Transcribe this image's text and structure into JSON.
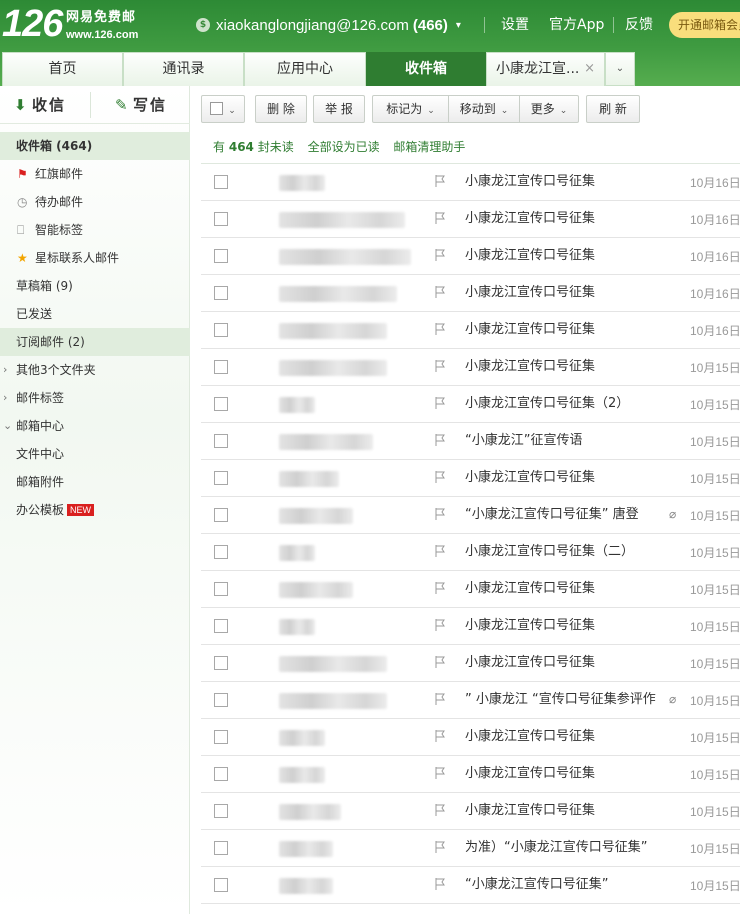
{
  "header": {
    "logo_number": "126",
    "logo_cn": "网易免费邮",
    "logo_url": "www.126.com",
    "coin_icon": "$",
    "account_email": "xiaokanglongjiang@126.com",
    "account_count": "(466)",
    "links": [
      "设置",
      "官方App",
      "反馈"
    ],
    "open_button": "开通邮箱会员"
  },
  "tabs": [
    {
      "label": "首页",
      "active": false
    },
    {
      "label": "通讯录",
      "active": false
    },
    {
      "label": "应用中心",
      "active": false
    },
    {
      "label": "收件箱",
      "active": true
    },
    {
      "label": "小康龙江宣...",
      "active": false,
      "closable": true
    }
  ],
  "tab_close_icon": "×",
  "tab_more_icon": "chevron-down-icon",
  "sidebar": {
    "receive_label": "收信",
    "write_label": "写信",
    "items": [
      {
        "label": "收件箱 (464)",
        "bold": true,
        "highlight": true
      },
      {
        "label": "红旗邮件",
        "icon": "red-flag-icon"
      },
      {
        "label": "待办邮件",
        "icon": "clock-icon"
      },
      {
        "label": "智能标签",
        "icon": "bookmark-icon"
      },
      {
        "label": "星标联系人邮件",
        "icon": "star-icon"
      },
      {
        "label": "草稿箱 (9)"
      },
      {
        "label": "已发送"
      },
      {
        "label": "订阅邮件 (2)",
        "highlight": true
      },
      {
        "label": "其他3个文件夹",
        "arrow": "›"
      },
      {
        "label": "邮件标签",
        "arrow": "›"
      },
      {
        "label": "邮箱中心",
        "arrow": "⌄"
      },
      {
        "label": "文件中心"
      },
      {
        "label": "邮箱附件"
      },
      {
        "label": "办公模板",
        "badge": "NEW"
      }
    ]
  },
  "toolbar": {
    "delete": "删 除",
    "report": "举 报",
    "mark_as": "标记为",
    "move_to": "移动到",
    "more": "更多",
    "refresh": "刷 新"
  },
  "status": {
    "prefix": "有",
    "count": "464",
    "suffix": "封未读",
    "mark_all": "全部设为已读",
    "cleaner": "邮箱清理助手"
  },
  "colors": {
    "header_green": "#3f9b41",
    "active_tab": "#2f7d31",
    "link_green": "#2f7d31",
    "open_button": "#f9de7c",
    "new_badge": "#d9201f"
  },
  "mails": [
    {
      "subject": "小康龙江宣传口号征集",
      "date": "10月16日"
    },
    {
      "subject": "小康龙江宣传口号征集",
      "date": "10月16日"
    },
    {
      "subject": "小康龙江宣传口号征集",
      "date": "10月16日"
    },
    {
      "subject": "小康龙江宣传口号征集",
      "date": "10月16日"
    },
    {
      "subject": "小康龙江宣传口号征集",
      "date": "10月16日"
    },
    {
      "subject": "小康龙江宣传口号征集",
      "date": "10月15日"
    },
    {
      "subject": "小康龙江宣传口号征集（2）",
      "date": "10月15日"
    },
    {
      "subject": "“小康龙江”征宣传语",
      "date": "10月15日"
    },
    {
      "subject": "小康龙江宣传口号征集",
      "date": "10月15日"
    },
    {
      "subject": "“小康龙江宣传口号征集” 唐登",
      "date": "10月15日",
      "attachment": true
    },
    {
      "subject": "小康龙江宣传口号征集（二）",
      "date": "10月15日"
    },
    {
      "subject": "小康龙江宣传口号征集",
      "date": "10月15日"
    },
    {
      "subject": "小康龙江宣传口号征集",
      "date": "10月15日"
    },
    {
      "subject": "小康龙江宣传口号征集",
      "date": "10月15日"
    },
    {
      "subject": "” 小康龙江 “宣传口号征集参评作",
      "date": "10月15日",
      "attachment": true
    },
    {
      "subject": "小康龙江宣传口号征集",
      "date": "10月15日"
    },
    {
      "subject": "小康龙江宣传口号征集",
      "date": "10月15日"
    },
    {
      "subject": "小康龙江宣传口号征集",
      "date": "10月15日"
    },
    {
      "subject": "为准）“小康龙江宣传口号征集”",
      "date": "10月15日"
    },
    {
      "subject": " “小康龙江宣传口号征集”",
      "date": "10月15日"
    }
  ]
}
